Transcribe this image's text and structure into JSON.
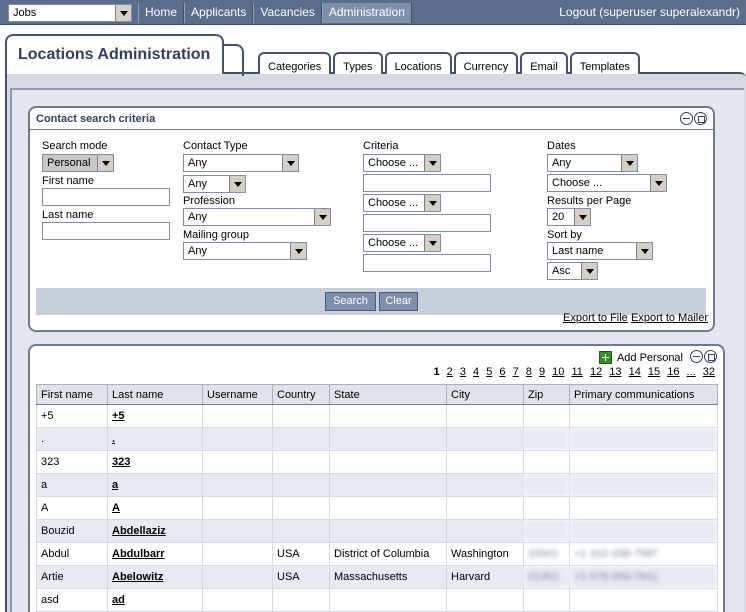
{
  "topbar": {
    "app_select": "Jobs",
    "nav": [
      "Home",
      "Applicants",
      "Vacancies",
      "Administration"
    ],
    "active_nav": "Administration",
    "logout": "Logout (superuser superalexandr)"
  },
  "header": {
    "title": "Locations Administration",
    "tabs": [
      "Categories",
      "Types",
      "Locations",
      "Currency",
      "Email",
      "Templates"
    ],
    "active_tab": "Locations"
  },
  "search": {
    "title": "Contact search criteria",
    "search_mode_label": "Search mode",
    "search_mode_value": "Personal",
    "first_name_label": "First name",
    "last_name_label": "Last name",
    "contact_type_label": "Contact Type",
    "contact_type_value": "Any",
    "contact_subtype_value": "Any",
    "profession_label": "Profession",
    "profession_value": "Any",
    "mailing_group_label": "Mailing group",
    "mailing_group_value": "Any",
    "criteria_label": "Criteria",
    "criteria_values": [
      "Choose ...",
      "Choose ...",
      "Choose ..."
    ],
    "dates_label": "Dates",
    "dates_value": "Any",
    "dates_choose_value": "Choose ...",
    "results_per_page_label": "Results per Page",
    "results_per_page_value": "20",
    "sort_by_label": "Sort by",
    "sort_by_value": "Last name",
    "sort_order_value": "Asc",
    "search_button": "Search",
    "clear_button": "Clear",
    "export_file": "Export to File",
    "export_mailer": "Export to Mailer"
  },
  "results": {
    "add_personal": "Add Personal",
    "pager": [
      "1",
      "2",
      "3",
      "4",
      "5",
      "6",
      "7",
      "8",
      "9",
      "10",
      "11",
      "12",
      "13",
      "14",
      "15",
      "16",
      "...",
      "32"
    ],
    "current_page": "1",
    "columns": [
      "First name",
      "Last name",
      "Username",
      "Country",
      "State",
      "City",
      "Zip",
      "Primary communications"
    ],
    "rows": [
      {
        "first": "+5",
        "last": "+5",
        "username": "",
        "country": "",
        "state": "",
        "city": "",
        "zip": "",
        "comm": ""
      },
      {
        "first": ".",
        "last": ".",
        "username": "",
        "country": "",
        "state": "",
        "city": "",
        "zip": "",
        "comm": ""
      },
      {
        "first": "323",
        "last": "323",
        "username": "",
        "country": "",
        "state": "",
        "city": "",
        "zip": "",
        "comm": ""
      },
      {
        "first": "a",
        "last": "a",
        "username": "",
        "country": "",
        "state": "",
        "city": "",
        "zip": "",
        "comm": ""
      },
      {
        "first": "A",
        "last": "A",
        "username": "",
        "country": "",
        "state": "",
        "city": "",
        "zip": "",
        "comm": ""
      },
      {
        "first": "Bouzid",
        "last": "Abdellaziz",
        "username": "",
        "country": "",
        "state": "",
        "city": "",
        "zip": "",
        "comm": ""
      },
      {
        "first": "Abdul",
        "last": "Abdulbarr",
        "username": "",
        "country": "USA",
        "state": "District of Columbia",
        "city": "Washington",
        "zip": "20001",
        "comm": "+1 202-338-7587"
      },
      {
        "first": "Artie",
        "last": "Abelowitz",
        "username": "",
        "country": "USA",
        "state": "Massachusetts",
        "city": "Harvard",
        "zip": "01451",
        "comm": "+1 978-456-7841"
      },
      {
        "first": "asd",
        "last": "ad",
        "username": "",
        "country": "",
        "state": "",
        "city": "",
        "zip": "",
        "comm": ""
      }
    ]
  }
}
